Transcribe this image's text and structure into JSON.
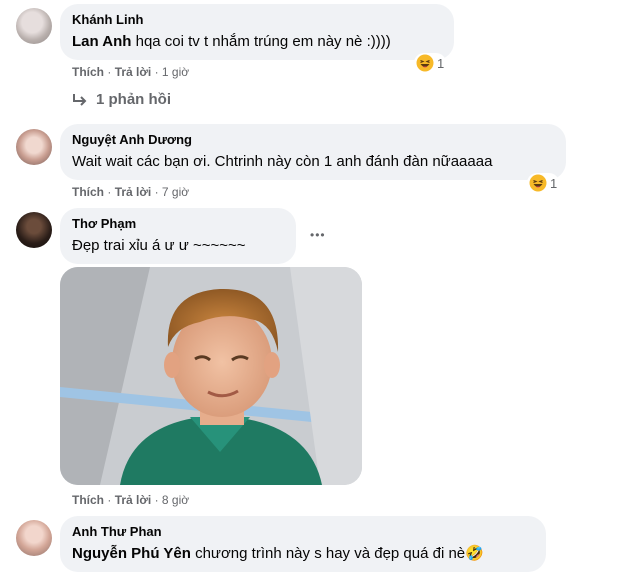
{
  "comments": [
    {
      "name": "Khánh Linh",
      "mention": "Lan Anh",
      "text": " hqa coi tv t nhắm trúng em này nè :))))",
      "like": "Thích",
      "reply": "Trả lời",
      "time": "1 giờ",
      "reaction_count": "1",
      "reaction_icon": "haha-icon"
    },
    {
      "name": "Nguyệt Anh Dương",
      "text": "Wait wait các bạn ơi. Chtrinh này còn 1 anh đánh đàn nữaaaaa",
      "like": "Thích",
      "reply": "Trả lời",
      "time": "7 giờ",
      "reaction_count": "1",
      "reaction_icon": "haha-icon"
    },
    {
      "name": "Thơ Phạm",
      "text": "Đẹp trai xỉu á ư ư ~~~~~~",
      "like": "Thích",
      "reply": "Trả lời",
      "time": "8 giờ",
      "more": "•••"
    },
    {
      "name": "Anh Thư Phan",
      "mention": "Nguyễn Phú Yên",
      "text": " chương trình này s hay và đẹp quá đi nè🤣"
    }
  ],
  "view_replies": "1 phản hồi",
  "separator": "·",
  "colors": {
    "bubble": "#f0f2f5",
    "meta": "#65676b",
    "text": "#050505"
  }
}
